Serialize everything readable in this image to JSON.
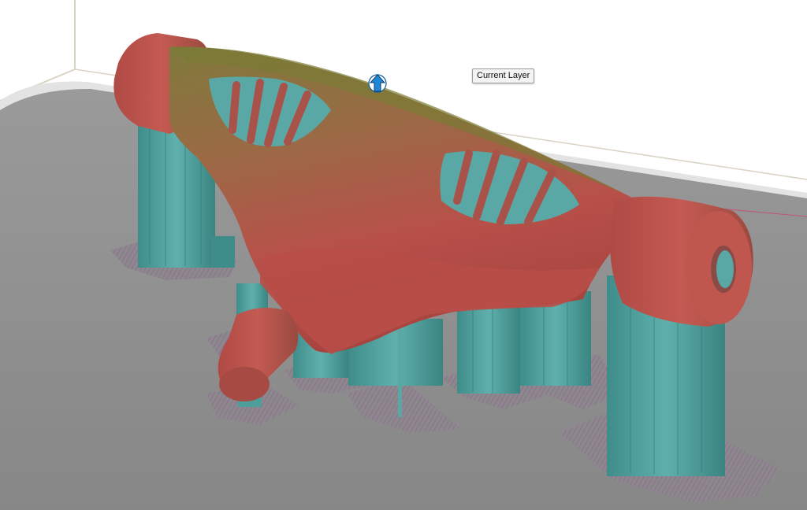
{
  "viewport": {
    "tooltip": "Current Layer",
    "handle_icon": "up-arrow-icon",
    "colors": {
      "background": "#ffffff",
      "build_plate": "#8f8f8f",
      "build_plate_rim": "#e8e8e8",
      "model": "#b5504a",
      "model_highlight": "#8c7a3a",
      "supports": "#4e9f9c",
      "brim": "#9b5fa0",
      "handle": "#1e88d6"
    }
  }
}
